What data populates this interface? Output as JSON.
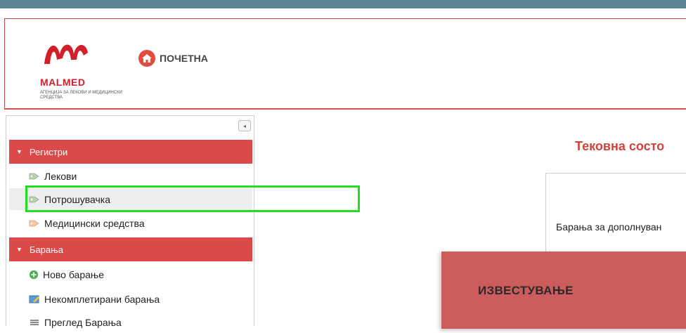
{
  "header": {
    "logo_name": "MALMED",
    "logo_subtitle": "АГЕНЦИЈА ЗА ЛЕКОВИ И МЕДИЦИНСКИ СРЕДСТВА",
    "home_label": "ПОЧЕТНА"
  },
  "sidebar": {
    "collapse_glyph": "◂",
    "sections": [
      {
        "label": "Регистри",
        "items": [
          {
            "label": "Лекови",
            "icon": "tag-icon"
          },
          {
            "label": "Потрошувачка",
            "icon": "tag-icon"
          },
          {
            "label": "Медицински средства",
            "icon": "tag-icon"
          }
        ]
      },
      {
        "label": "Барања",
        "items": [
          {
            "label": "Ново барање",
            "icon": "plus-circle-icon"
          },
          {
            "label": "Некомплетирани барања",
            "icon": "edit-icon"
          },
          {
            "label": "Преглед Барања",
            "icon": "list-icon"
          }
        ]
      }
    ]
  },
  "main": {
    "title": "Тековна состо",
    "panel_text": "Барања за дополнуван"
  },
  "notification": {
    "title": "ИЗВЕСТУВАЊЕ"
  },
  "colors": {
    "accent": "#db4a48",
    "topbar": "#5b8593",
    "highlight": "#22dd22",
    "notification_bg": "#cd5c5c"
  }
}
